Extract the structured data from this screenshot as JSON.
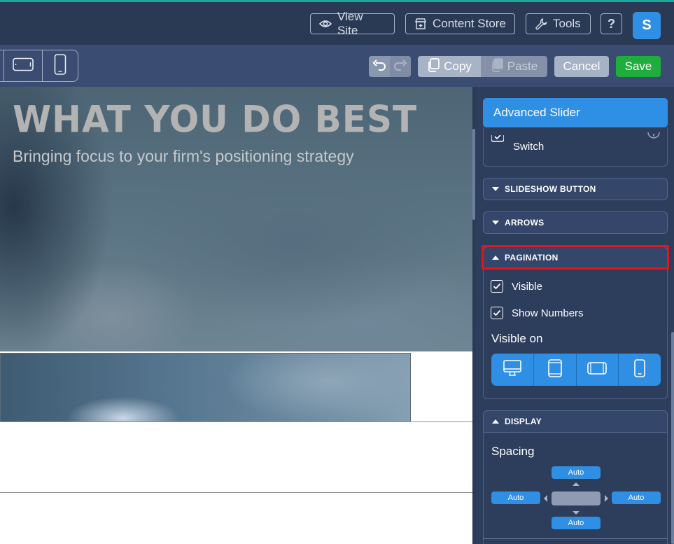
{
  "topbar": {
    "view_site": "View Site",
    "content_store": "Content Store",
    "tools": "Tools",
    "help": "?",
    "avatar_initial": "S"
  },
  "toolbar": {
    "copy": "Copy",
    "paste": "Paste",
    "cancel": "Cancel",
    "save": "Save"
  },
  "canvas": {
    "hero_title": "WHAT YOU DO BEST",
    "hero_subtitle": "Bringing focus to your firm's positioning strategy"
  },
  "panel": {
    "header": "Advanced Slider",
    "switch_label": "Switch",
    "sections": {
      "slideshow_button": "SLIDESHOW BUTTON",
      "arrows": "ARROWS",
      "pagination": "PAGINATION",
      "display": "DISPLAY"
    },
    "pagination": {
      "visible_label": "Visible",
      "visible_checked": true,
      "show_numbers_label": "Show Numbers",
      "show_numbers_checked": true,
      "visible_on_label": "Visible on",
      "devices": [
        "desktop-icon",
        "tablet-portrait-icon",
        "tablet-landscape-icon",
        "phone-icon"
      ]
    },
    "display": {
      "spacing_label": "Spacing",
      "top": "Auto",
      "left": "Auto",
      "right": "Auto",
      "bottom": "Auto"
    }
  },
  "colors": {
    "accent": "#2f8fe4",
    "save": "#1fae3d",
    "highlight": "#e3141b",
    "panel_bg": "#2d3d5c"
  }
}
